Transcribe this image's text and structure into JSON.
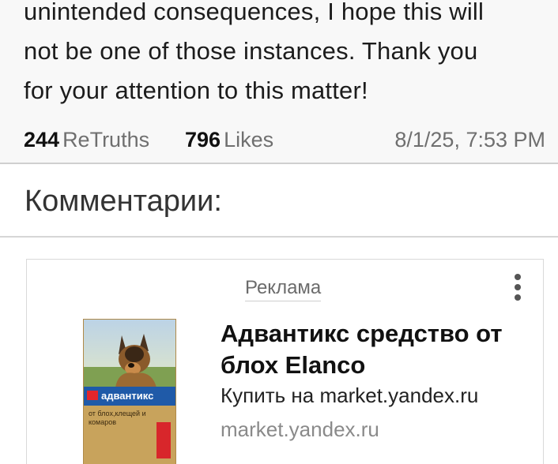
{
  "post": {
    "lines": [
      "unintended consequences, I hope this will",
      "not be one of those instances. Thank you",
      "for your attention to this matter!"
    ],
    "retruths_count": "244",
    "retruths_label": "ReTruths",
    "likes_count": "796",
    "likes_label": "Likes",
    "timestamp": "8/1/25, 7:53 PM"
  },
  "comments": {
    "title": "Комментарии:"
  },
  "ad": {
    "label": "Реклама",
    "title": "Адвантикс средство от блох Elanco",
    "cta": "Купить на market.yandex.ru",
    "domain": "market.yandex.ru",
    "image": {
      "brand": "адвантикс",
      "tagline": "от блох,клещей и комаров"
    },
    "more_icon": "vertical-dots-icon"
  }
}
